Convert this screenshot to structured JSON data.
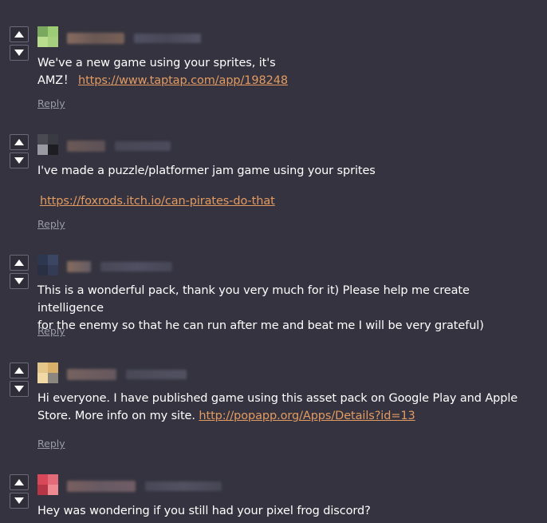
{
  "comments": [
    {
      "text_line1": "We've a new game using your sprites, it's",
      "text_line2": "AMZ！ ",
      "link": "https://www.taptap.com/app/198248",
      "reply_label": "Reply",
      "avatar_colors": [
        "#8cbf6c",
        "#a9d47c",
        "#6e9d57",
        "#c7e29b"
      ]
    },
    {
      "text_line1": "I've made a puzzle/platformer jam game using your sprites",
      "link": "https://foxrods.itch.io/can-pirates-do-that",
      "reply_label": "Reply",
      "avatar_colors": [
        "#555560",
        "#8a8a92",
        "#222226",
        "#cfcfd4"
      ]
    },
    {
      "text_line1": "This is a wonderful pack, thank you very much for it) Please help me create intelligence",
      "text_line2": "for the enemy so that he can run after me and beat me I will be very grateful)",
      "reply_label": "Reply",
      "avatar_colors": [
        "#2f3a55",
        "#3d4a6a",
        "#253049",
        "#4a587a"
      ]
    },
    {
      "text_line1": "Hi everyone. I have published game using this asset pack on Google Play and Apple",
      "text_line2": "Store. More info on my site. ",
      "link": "http://popapp.org/Apps/Details?id=13",
      "reply_label": "Reply",
      "avatar_colors": [
        "#e7c889",
        "#d9b46a",
        "#f2dca8",
        "#8f8a80"
      ]
    },
    {
      "text_line1": "Hey was wondering if you still had your pixel frog discord?",
      "avatar_colors": [
        "#d9485a",
        "#e86a78",
        "#b83445",
        "#f08c92"
      ]
    }
  ],
  "colors": {
    "background": "#34333f",
    "link": "#e39b62",
    "reply": "#9a9aa8",
    "text": "#ffffff"
  }
}
